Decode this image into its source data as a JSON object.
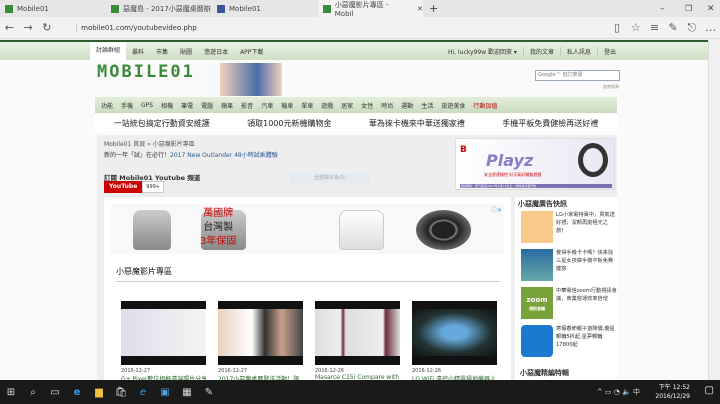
{
  "browser": {
    "tabs": [
      {
        "label": "Mobile01"
      },
      {
        "label": "惡魔島 - 2017小惡魔桌曆辦"
      },
      {
        "label": "Mobile01"
      },
      {
        "label": "小惡魔影片專區 - Mobil"
      }
    ],
    "url": "mobile01.com/youtubevideo.php"
  },
  "topnav": {
    "items": [
      "討論群組",
      "暴料",
      "市集",
      "貼圖",
      "悠遊日本",
      "APP下載"
    ],
    "user": "Hi, lucky99w 歡迎回來 ▾",
    "my_posts": "我的文章",
    "messages": "私人訊息",
    "logout": "登出"
  },
  "logo": "MOBILE01",
  "search": {
    "placeholder": "Google™ 自訂搜尋",
    "advanced": "進階搜尋"
  },
  "categories": [
    "功能",
    "手機",
    "GPS",
    "相機",
    "筆電",
    "電腦",
    "蘋果",
    "影音",
    "汽車",
    "機車",
    "單車",
    "遊戲",
    "居家",
    "女性",
    "時尚",
    "運動",
    "生活",
    "旅遊美食",
    "行動加值"
  ],
  "promos": [
    "一站統包搞定行動資安維護",
    "領取1000元新機購物金",
    "華為徠卡機來中華送獨家禮",
    "手機平板免費健檢再送好禮"
  ],
  "breadcrumb": "Mobile01 首頁 » 小惡魔影片專區",
  "news": {
    "prefix": "新的一年「試」在必行！",
    "link": "2017 New Outlander 48小時試乘體驗"
  },
  "subscribe": {
    "label": "訂閱 Mobile01 Youtube 頻道",
    "button": "YouTube",
    "count": "999+"
  },
  "mark_all_read": "全部標示為(5)",
  "bs_ad": {
    "brand": "B",
    "title": "Playz",
    "sub": "安全舒適操控 好天氣好開路遊戲",
    "footer": "活動期間：即日起至2017年1月31日止，詳情請洽各門市"
  },
  "appliance_ad": {
    "brand": "萬國牌",
    "line2": "台灣製",
    "line3": "3年保固"
  },
  "section_title": "小惡魔影片專區",
  "videos": [
    {
      "date": "2016-12-27",
      "title": "G+ Pixer數位相框遠端照片分享"
    },
    {
      "date": "2016-12-27",
      "title": "2017小惡魔桌曆發送活動！限"
    },
    {
      "date": "2016-12-26",
      "title": "Masarce C15i Compare with"
    },
    {
      "date": "2016-12-26",
      "title": "LG WiFi 遠控小精靈掃地機器人"
    }
  ],
  "sidebar": {
    "title": "小惡魔廣告快訊",
    "items": [
      {
        "text": "LG小家電特賣中，買氣送好禮，潔顏再拋極光之旅！"
      },
      {
        "text": "覺得手機卡卡嗎？快來找三星女孩做手機平板免費健檢"
      },
      {
        "text": "中華電信zoom行動視訊會議，商業營運效率倍增"
      },
      {
        "text": "寒假春節親子遊降價,龍星郵輪5折起,星夢郵輪17800起"
      }
    ],
    "zoom_logo": "zoom",
    "zoom_sub": "視訊會議",
    "second_title": "小惡魔精編特輯"
  },
  "taskbar": {
    "time": "下午 12:52",
    "date": "2016/12/29",
    "ime": "中"
  }
}
